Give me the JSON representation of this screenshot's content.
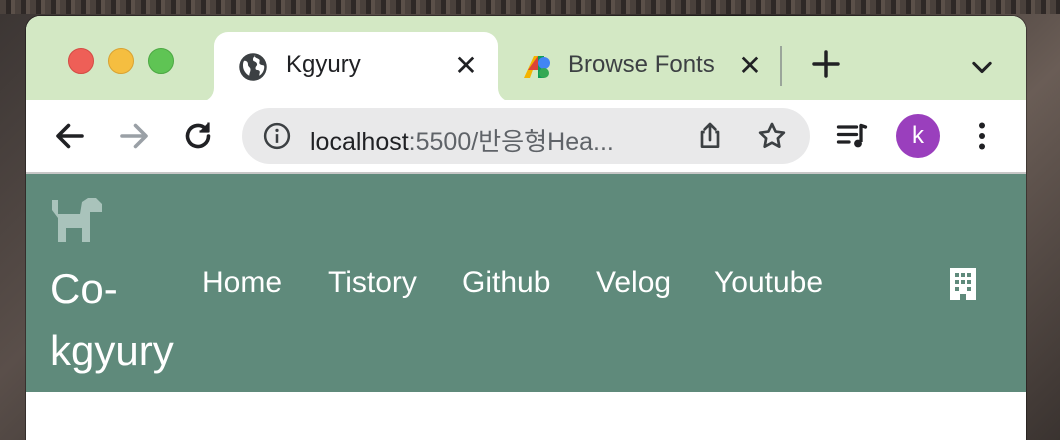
{
  "tabs": [
    {
      "title": "Kgyury",
      "icon": "globe-icon",
      "active": true
    },
    {
      "title": "Browse Fonts",
      "icon": "google-fonts-icon",
      "active": false
    }
  ],
  "address_bar": {
    "host": "localhost",
    "rest": ":5500/반응형Hea..."
  },
  "profile": {
    "initial": "k",
    "color": "#9a3fbd"
  },
  "site": {
    "brand": "Co-kgyury",
    "brand_line1": "Co-",
    "brand_line2": "kgyury",
    "header_color": "#5f8a7b",
    "logo_icon": "dog-icon",
    "nav": [
      {
        "label": "Home"
      },
      {
        "label": "Tistory"
      },
      {
        "label": "Github"
      },
      {
        "label": "Velog"
      },
      {
        "label": "Youtube"
      }
    ],
    "right_icon": "building-icon"
  },
  "colors": {
    "tabstrip": "#d3e8c4",
    "accent": "#5f8a7b"
  }
}
